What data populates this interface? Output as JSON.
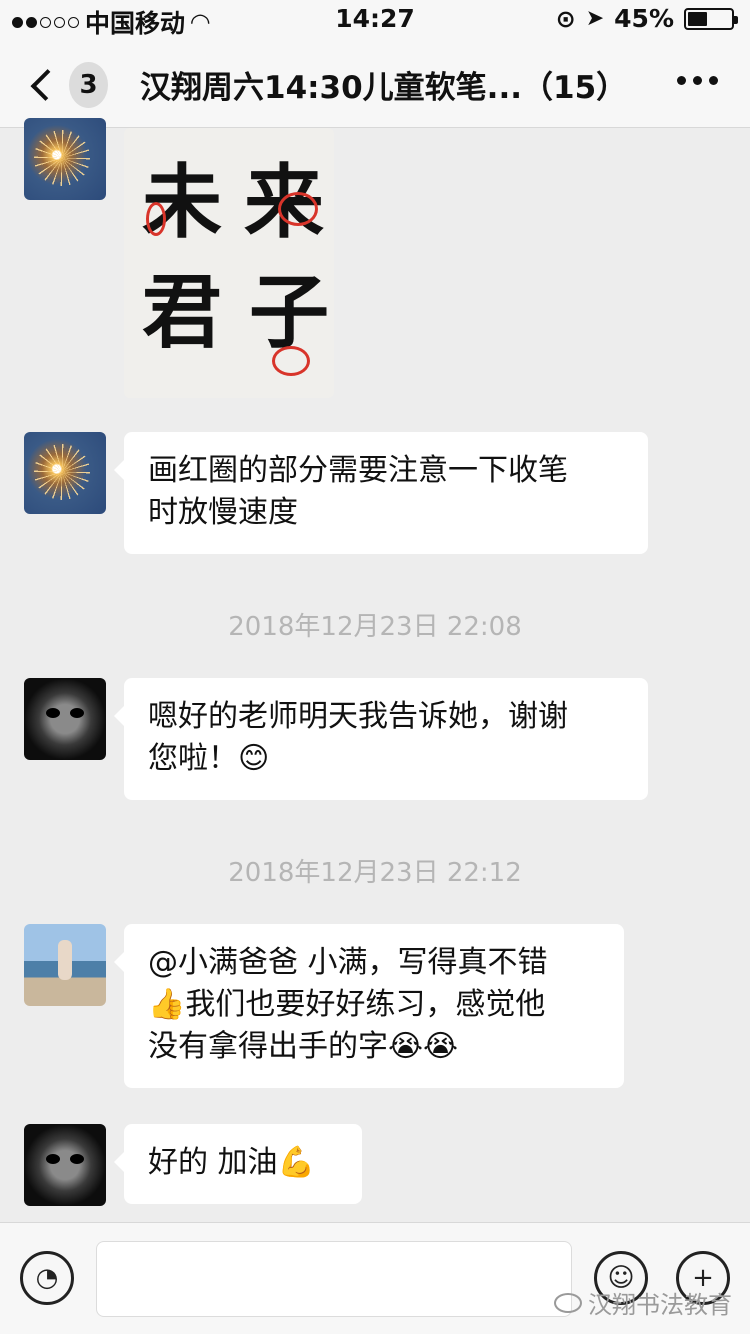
{
  "status_bar": {
    "carrier": "中国移动",
    "time": "14:27",
    "battery": "45%",
    "battery_level": 0.45
  },
  "nav": {
    "back_count": "3",
    "title": "汉翔周六14:30儿童软笔...（15）"
  },
  "messages": [
    {
      "type": "image",
      "avatar": "sparkler-avatar"
    },
    {
      "type": "text",
      "avatar": "sparkler-avatar",
      "text_line1": "画红圈的部分需要注意一下收笔",
      "text_line2": "时放慢速度"
    },
    {
      "type": "time",
      "text": "2018年12月23日 22:08"
    },
    {
      "type": "text",
      "avatar": "skull-avatar",
      "text_line1": "嗯好的老师明天我告诉她，谢谢",
      "text_line2": "您啦！",
      "emoji": "😊"
    },
    {
      "type": "time",
      "text": "2018年12月23日 22:12"
    },
    {
      "type": "text",
      "avatar": "photo-avatar",
      "text_line1": "@小满爸爸 小满，写得真不错",
      "text_line2_emoji": "👍",
      "text_line2": "我们也要好好练习，感觉他",
      "text_line3": "没有拿得出手的字",
      "text_line3_emoji": "😭😭"
    },
    {
      "type": "text",
      "avatar": "skull-avatar",
      "text_line1": "好的 加油",
      "emoji": "💪"
    }
  ],
  "image_characters": [
    "未",
    "来",
    "君",
    "子"
  ],
  "input_bar": {
    "voice_icon": "voice-icon",
    "emoji_icon": "emoji-icon",
    "plus_icon": "plus-icon",
    "watermark": "汉翔书法教育"
  },
  "colors": {
    "background": "#ededed",
    "bubble": "#ffffff",
    "timestamp": "#b5b5b5",
    "red_mark": "#d8342a"
  }
}
